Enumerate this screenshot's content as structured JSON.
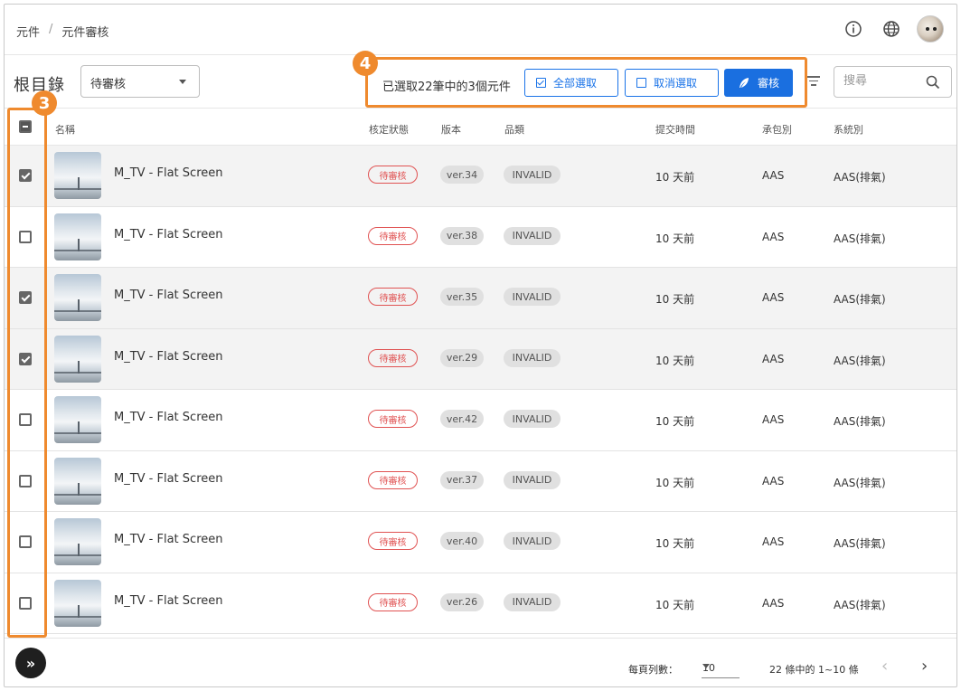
{
  "breadcrumb": [
    "元件",
    "元件審核"
  ],
  "breadcrumb_sep": "/",
  "header_icons": [
    "info-icon",
    "globe-icon",
    "avatar"
  ],
  "toolbar": {
    "root_title": "根目錄",
    "status_filter": "待審核",
    "selection_text": "已選取22筆中的3個元件",
    "select_all_label": "全部選取",
    "deselect_label": "取消選取",
    "review_label": "審核",
    "search_placeholder": "搜尋"
  },
  "markers": {
    "selection_bar": "4",
    "checkbox_column": "3"
  },
  "colors": {
    "accent": "#1a6fe0",
    "highlight": "#ef8a2e",
    "status_red": "#e05252"
  },
  "columns": [
    "名稱",
    "核定狀態",
    "版本",
    "品類",
    "提交時間",
    "承包別",
    "系統別"
  ],
  "rows": [
    {
      "checked": true,
      "name": "M_TV - Flat Screen",
      "status": "待審核",
      "version": "ver.34",
      "category": "INVALID",
      "submitted": "10 天前",
      "contractor": "AAS",
      "system": "AAS(排氣)"
    },
    {
      "checked": false,
      "name": "M_TV - Flat Screen",
      "status": "待審核",
      "version": "ver.38",
      "category": "INVALID",
      "submitted": "10 天前",
      "contractor": "AAS",
      "system": "AAS(排氣)"
    },
    {
      "checked": true,
      "name": "M_TV - Flat Screen",
      "status": "待審核",
      "version": "ver.35",
      "category": "INVALID",
      "submitted": "10 天前",
      "contractor": "AAS",
      "system": "AAS(排氣)"
    },
    {
      "checked": true,
      "name": "M_TV - Flat Screen",
      "status": "待審核",
      "version": "ver.29",
      "category": "INVALID",
      "submitted": "10 天前",
      "contractor": "AAS",
      "system": "AAS(排氣)"
    },
    {
      "checked": false,
      "name": "M_TV - Flat Screen",
      "status": "待審核",
      "version": "ver.42",
      "category": "INVALID",
      "submitted": "10 天前",
      "contractor": "AAS",
      "system": "AAS(排氣)"
    },
    {
      "checked": false,
      "name": "M_TV - Flat Screen",
      "status": "待審核",
      "version": "ver.37",
      "category": "INVALID",
      "submitted": "10 天前",
      "contractor": "AAS",
      "system": "AAS(排氣)"
    },
    {
      "checked": false,
      "name": "M_TV - Flat Screen",
      "status": "待審核",
      "version": "ver.40",
      "category": "INVALID",
      "submitted": "10 天前",
      "contractor": "AAS",
      "system": "AAS(排氣)"
    },
    {
      "checked": false,
      "name": "M_TV - Flat Screen",
      "status": "待審核",
      "version": "ver.26",
      "category": "INVALID",
      "submitted": "10 天前",
      "contractor": "AAS",
      "system": "AAS(排氣)"
    }
  ],
  "pagination": {
    "rows_per_page_label": "每頁列數：",
    "rows_per_page": "10",
    "range_text": "22 條中的 1~10 條"
  }
}
